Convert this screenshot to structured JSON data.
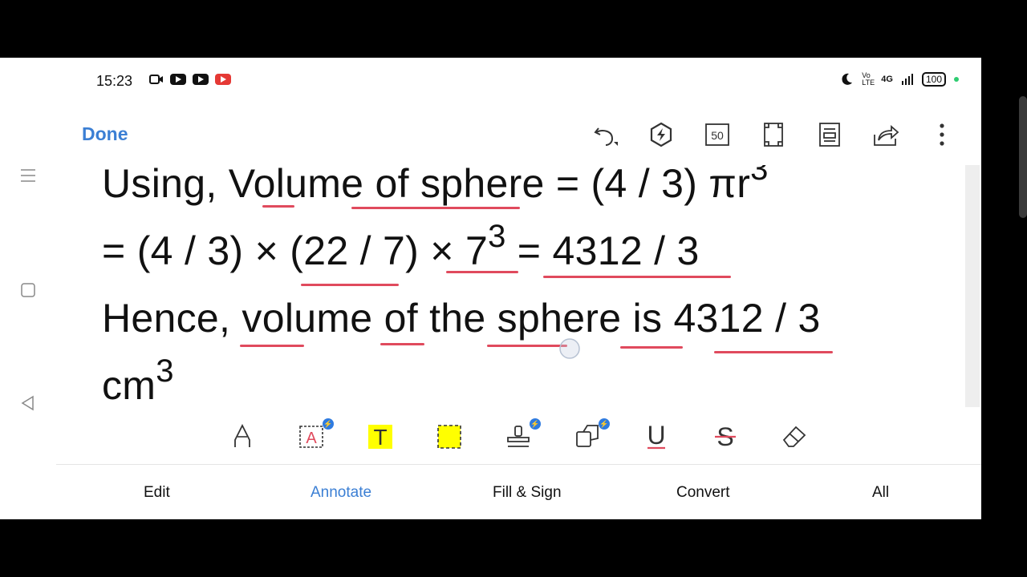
{
  "status_bar": {
    "time": "15:23",
    "battery": "100",
    "network": "4G",
    "volte": "Vo LTE"
  },
  "toolbar": {
    "done_label": "Done",
    "page_counter": "50"
  },
  "document": {
    "line1_text": "Using, Volume of sphere = (4 / 3) πr",
    "line1_sup": "3",
    "line2_text": "= (4 / 3) × (22 / 7) × 7",
    "line2_sup": "3",
    "line2_tail": " = 4312 / 3",
    "line3_text": "Hence, volume of the sphere is 4312 / 3",
    "line4_text": "cm",
    "line4_sup": "3"
  },
  "tools": {
    "text_tool_glyph": "T",
    "textbox_tool_glyph": "A",
    "underline_glyph": "U",
    "strike_glyph": "S"
  },
  "tabs": [
    {
      "label": "Edit"
    },
    {
      "label": "Annotate"
    },
    {
      "label": "Fill & Sign"
    },
    {
      "label": "Convert"
    },
    {
      "label": "All"
    }
  ],
  "colors": {
    "accent": "#3b7fd4",
    "underline": "#e04a5d",
    "highlight": "#ffff00"
  }
}
